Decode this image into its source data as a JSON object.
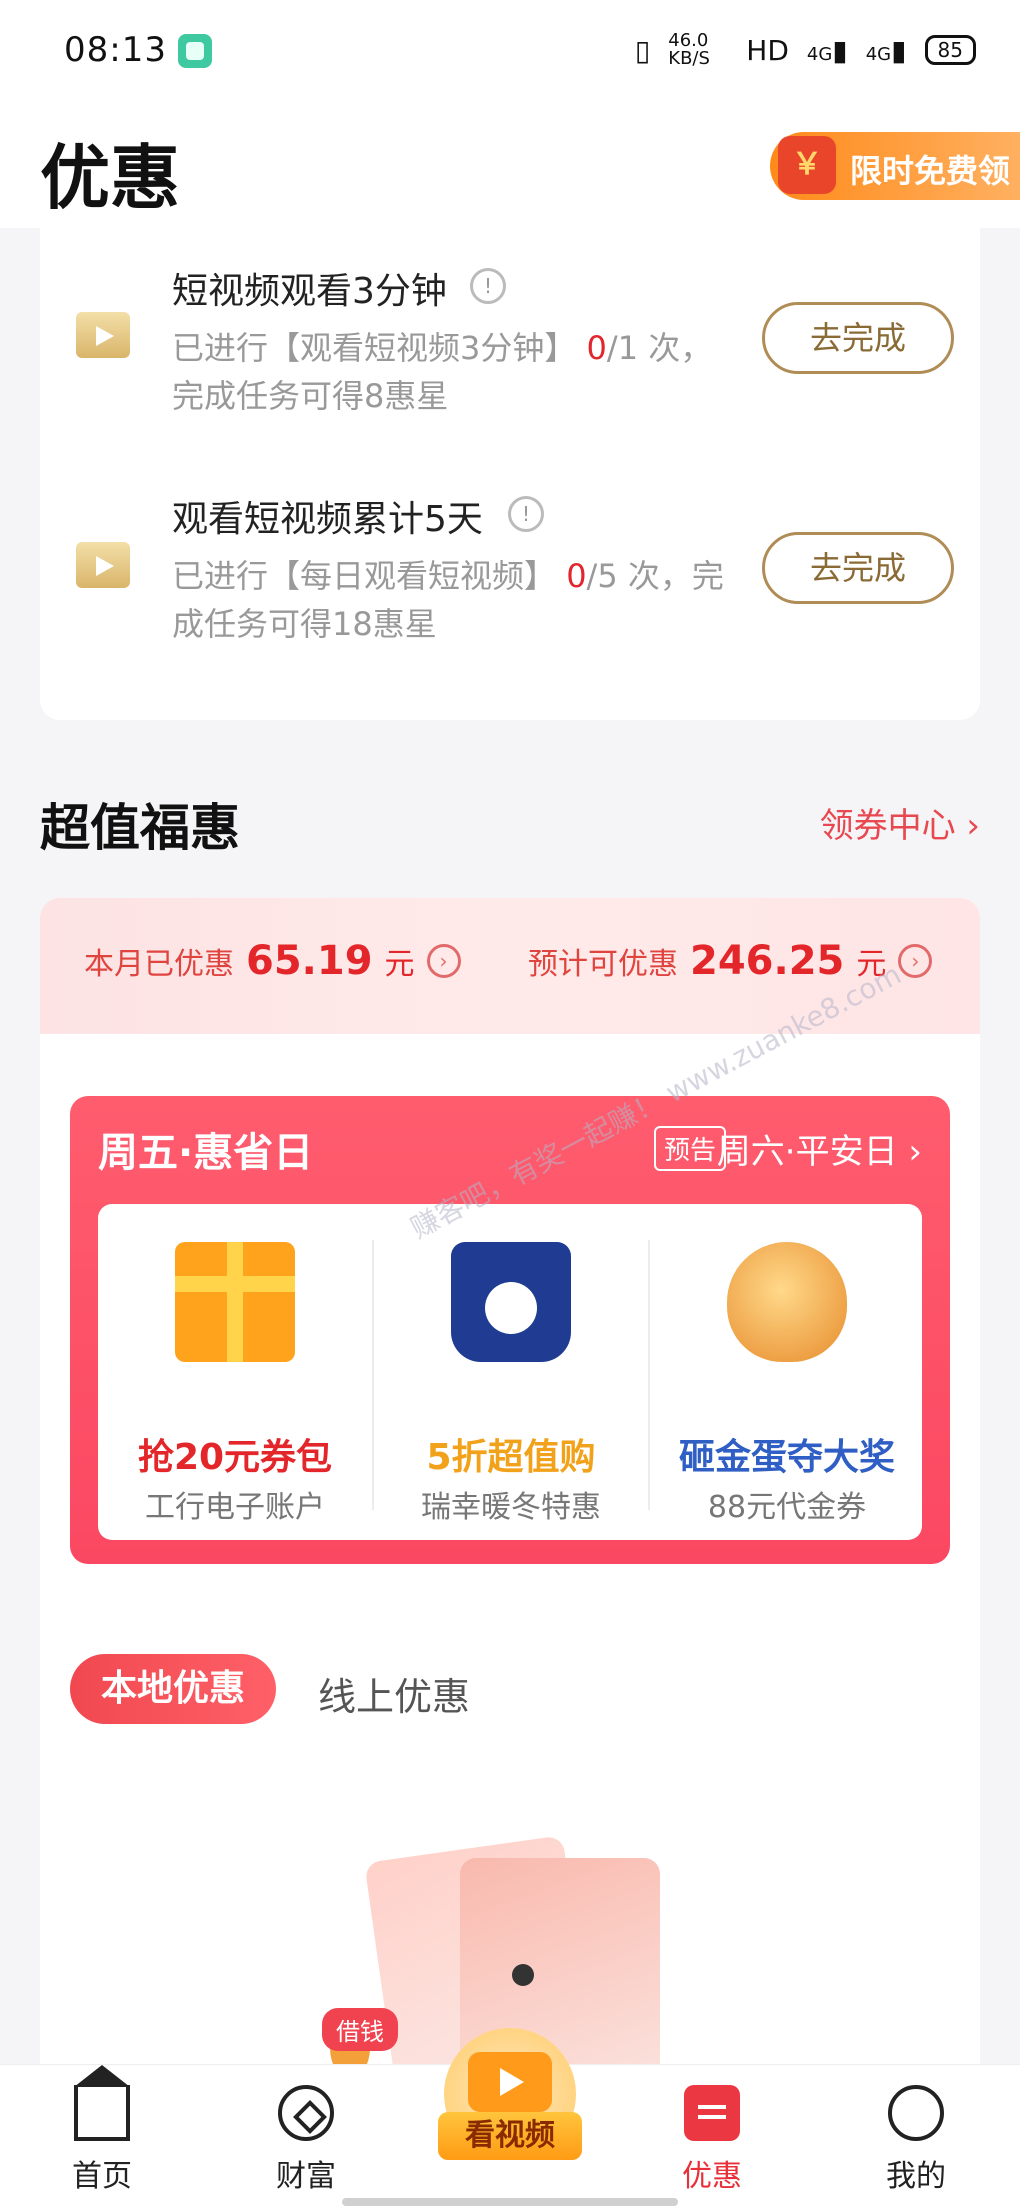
{
  "status_bar": {
    "time": "08:13",
    "speed": "46.0 KB/S",
    "hd": "HD",
    "net1": "4G",
    "net2": "4G",
    "battery": "85"
  },
  "header": {
    "title": "优惠",
    "promo_label": "限时免费领"
  },
  "tasks": [
    {
      "title": "短视频观看3分钟",
      "desc_prefix": "已进行【观看短视频3分钟】",
      "done": "0",
      "total": "/1",
      "desc_suffix": "次，完成任务可得8惠星",
      "button": "去完成"
    },
    {
      "title": "观看短视频累计5天",
      "desc_prefix": "已进行【每日观看短视频】",
      "done": "0",
      "total": "/5",
      "desc_suffix": "次，完成任务可得18惠星",
      "button": "去完成"
    }
  ],
  "section": {
    "title": "超值福惠",
    "link": "领券中心 ›"
  },
  "stats": {
    "month_label": "本月已优惠",
    "month_value": "65.19",
    "month_unit": "元",
    "expect_label": "预计可优惠",
    "expect_value": "246.25",
    "expect_unit": "元"
  },
  "day_banner": {
    "today": "周五·惠省日",
    "tag": "预告",
    "next": "周六·平安日 ›"
  },
  "deals": [
    {
      "main": "抢20元券包",
      "sub": "工行电子账户",
      "color": "#e3262a"
    },
    {
      "main": "5折超值购",
      "sub": "瑞幸暖冬特惠",
      "color": "#f2a21a"
    },
    {
      "main": "砸金蛋夺大奖",
      "sub": "88元代金券",
      "color": "#2f5ec4"
    }
  ],
  "tabs": {
    "local": "本地优惠",
    "online": "线上优惠"
  },
  "watermark": "赚客吧，有奖一起赚！ www.zuanke8.com",
  "nav": {
    "home": "首页",
    "wealth": "财富",
    "loan_badge": "借钱",
    "video": "看视频",
    "benefit": "优惠",
    "me": "我的"
  }
}
